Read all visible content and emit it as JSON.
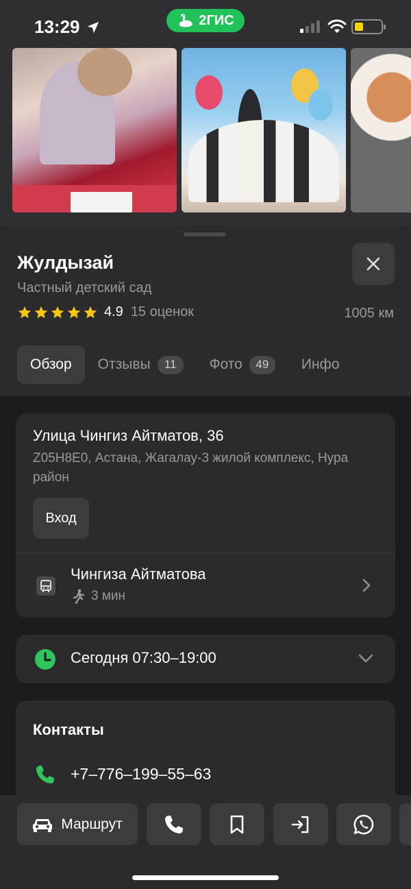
{
  "status_bar": {
    "time": "13:29",
    "app_badge": "2ГИС",
    "battery_color": "#f5d400",
    "icons": [
      "location-arrow-icon",
      "signal-icon",
      "wifi-icon",
      "battery-icon"
    ]
  },
  "photos": [
    {
      "name": "photo-children-crafts"
    },
    {
      "name": "photo-graduation-party"
    },
    {
      "name": "photo-food-plates"
    }
  ],
  "place": {
    "name": "Жулдызай",
    "category": "Частный детский сад",
    "rating": "4.9",
    "stars": 5,
    "reviews": "15 оценок",
    "distance": "1005 км"
  },
  "tabs": [
    {
      "label": "Обзор",
      "active": true
    },
    {
      "label": "Отзывы",
      "badge": "11"
    },
    {
      "label": "Фото",
      "badge": "49"
    },
    {
      "label": "Инфо"
    }
  ],
  "address": {
    "main": "Улица Чингиз Айтматов, 36",
    "sub": "Z05H8E0, Астана, Жагалау-3 жилой комплекс, Нура район",
    "entry_label": "Вход"
  },
  "transit": {
    "stop": "Чингиза Айтматова",
    "walk_time": "3 мин"
  },
  "hours": {
    "text": "Сегодня 07:30–19:00"
  },
  "contacts": {
    "title": "Контакты",
    "phone": "+7‒776‒199‒55‒63"
  },
  "actions": {
    "route_label": "Маршрут"
  },
  "colors": {
    "accent_green": "#21c25a",
    "star": "#f5c518",
    "background": "#1c1c1e",
    "card": "#2b2b2d"
  }
}
